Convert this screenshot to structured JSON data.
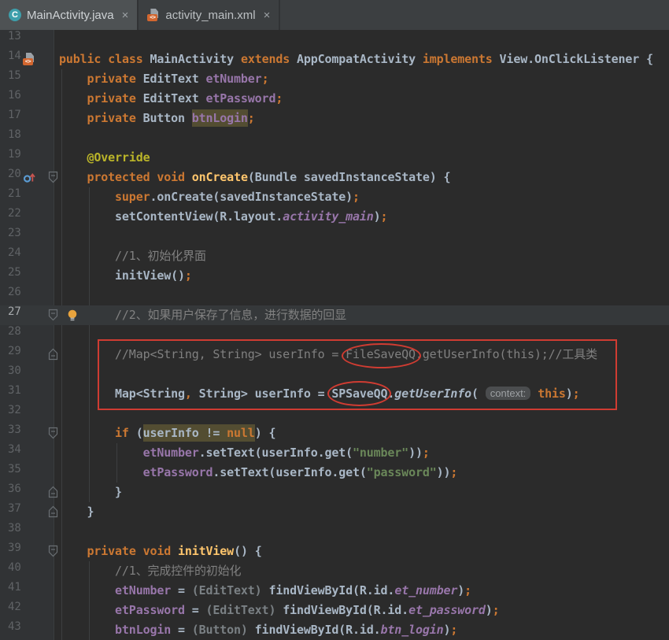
{
  "tabs": [
    {
      "label": "MainActivity.java",
      "close_label": "×",
      "icon": "java-class-icon",
      "active": true
    },
    {
      "label": "activity_main.xml",
      "close_label": "×",
      "icon": "xml-file-icon",
      "active": false
    }
  ],
  "icons": {
    "java_letter": "C",
    "xml_badge": "<>"
  },
  "editor": {
    "current_line": 27,
    "first_line": 13,
    "last_line": 43,
    "colors": {
      "background": "#2b2b2b",
      "gutter": "#313335",
      "caret_row": "#35383a",
      "keyword": "#cc7832",
      "text": "#a9b7c6",
      "field": "#9876aa",
      "method": "#ffc66d",
      "annotation": "#bbb529",
      "comment": "#808080",
      "string": "#6a8759",
      "line_number": "#606366",
      "selection": "#534d32"
    },
    "lines": [
      {
        "n": 13,
        "tokens": []
      },
      {
        "n": 14,
        "gutter": "layout-icon",
        "tokens": [
          {
            "s": "public",
            "c": "kw"
          },
          {
            "s": " ",
            "c": "txt"
          },
          {
            "s": "class",
            "c": "kw"
          },
          {
            "s": " MainActivity ",
            "c": "txt"
          },
          {
            "s": "extends",
            "c": "kw"
          },
          {
            "s": " AppCompatActivity ",
            "c": "txt"
          },
          {
            "s": "implements",
            "c": "kw"
          },
          {
            "s": " View.OnClickListener {",
            "c": "txt"
          }
        ]
      },
      {
        "n": 15,
        "tokens": [
          {
            "s": "    ",
            "c": "txt"
          },
          {
            "s": "private",
            "c": "kw"
          },
          {
            "s": " EditText ",
            "c": "txt"
          },
          {
            "s": "etNumber",
            "c": "fld"
          },
          {
            "s": ";",
            "c": "pun"
          }
        ]
      },
      {
        "n": 16,
        "tokens": [
          {
            "s": "    ",
            "c": "txt"
          },
          {
            "s": "private",
            "c": "kw"
          },
          {
            "s": " EditText ",
            "c": "txt"
          },
          {
            "s": "etPassword",
            "c": "fld"
          },
          {
            "s": ";",
            "c": "pun"
          }
        ]
      },
      {
        "n": 17,
        "tokens": [
          {
            "s": "    ",
            "c": "txt"
          },
          {
            "s": "private",
            "c": "kw"
          },
          {
            "s": " Button ",
            "c": "txt"
          },
          {
            "s": "btnLogin",
            "c": "fld",
            "hl": true
          },
          {
            "s": ";",
            "c": "pun"
          }
        ]
      },
      {
        "n": 18,
        "tokens": []
      },
      {
        "n": 19,
        "tokens": [
          {
            "s": "    ",
            "c": "txt"
          },
          {
            "s": "@Override",
            "c": "ann"
          }
        ]
      },
      {
        "n": 20,
        "gutter": "override-icon",
        "fold": "down",
        "tokens": [
          {
            "s": "    ",
            "c": "txt"
          },
          {
            "s": "protected",
            "c": "kw"
          },
          {
            "s": " ",
            "c": "txt"
          },
          {
            "s": "void",
            "c": "kw"
          },
          {
            "s": " ",
            "c": "txt"
          },
          {
            "s": "onCreate",
            "c": "mth"
          },
          {
            "s": "(Bundle savedInstanceState) {",
            "c": "txt"
          }
        ]
      },
      {
        "n": 21,
        "tokens": [
          {
            "s": "        ",
            "c": "txt"
          },
          {
            "s": "super",
            "c": "kw"
          },
          {
            "s": ".onCreate(savedInstanceState)",
            "c": "txt"
          },
          {
            "s": ";",
            "c": "pun"
          }
        ]
      },
      {
        "n": 22,
        "tokens": [
          {
            "s": "        setContentView(R.layout.",
            "c": "txt"
          },
          {
            "s": "activity_main",
            "c": "fldi"
          },
          {
            "s": ")",
            "c": "txt"
          },
          {
            "s": ";",
            "c": "pun"
          }
        ]
      },
      {
        "n": 23,
        "tokens": []
      },
      {
        "n": 24,
        "tokens": [
          {
            "s": "        ",
            "c": "txt"
          },
          {
            "s": "//1、初始化界面",
            "c": "cmt"
          }
        ]
      },
      {
        "n": 25,
        "tokens": [
          {
            "s": "        initView()",
            "c": "txt"
          },
          {
            "s": ";",
            "c": "pun"
          }
        ]
      },
      {
        "n": 26,
        "tokens": []
      },
      {
        "n": 27,
        "fold": "down",
        "bulb": true,
        "tokens": [
          {
            "s": "        ",
            "c": "txt"
          },
          {
            "s": "//2、如果用户保存了信息，进行数据的回显",
            "c": "cmt"
          }
        ]
      },
      {
        "n": 28,
        "tokens": []
      },
      {
        "n": 29,
        "fold": "up",
        "tokens": [
          {
            "s": "        ",
            "c": "txt"
          },
          {
            "s": "//Map<String, String> userInfo = FileSaveQQ.getUserInfo(this);//工具类",
            "c": "cmt"
          }
        ]
      },
      {
        "n": 30,
        "tokens": []
      },
      {
        "n": 31,
        "tokens": [
          {
            "s": "        Map<String",
            "c": "txt"
          },
          {
            "s": ",",
            "c": "pun"
          },
          {
            "s": " String> userInfo = SPSaveQQ.",
            "c": "txt"
          },
          {
            "s": "getUserInfo",
            "c": "mthi"
          },
          {
            "s": "( ",
            "c": "txt"
          },
          {
            "s": "context:",
            "c": "chip"
          },
          {
            "s": " ",
            "c": "txt"
          },
          {
            "s": "this",
            "c": "kw"
          },
          {
            "s": ")",
            "c": "txt"
          },
          {
            "s": ";",
            "c": "pun"
          }
        ]
      },
      {
        "n": 32,
        "tokens": []
      },
      {
        "n": 33,
        "fold": "down",
        "tokens": [
          {
            "s": "        ",
            "c": "txt"
          },
          {
            "s": "if",
            "c": "kw"
          },
          {
            "s": " (",
            "c": "txt"
          },
          {
            "s": "userInfo != ",
            "c": "txt",
            "hl": true
          },
          {
            "s": "null",
            "c": "kw",
            "hl": true
          },
          {
            "s": ") {",
            "c": "txt"
          }
        ]
      },
      {
        "n": 34,
        "tokens": [
          {
            "s": "            ",
            "c": "txt"
          },
          {
            "s": "etNumber",
            "c": "fld"
          },
          {
            "s": ".setText(userInfo.get(",
            "c": "txt"
          },
          {
            "s": "\"number\"",
            "c": "str"
          },
          {
            "s": "))",
            "c": "txt"
          },
          {
            "s": ";",
            "c": "pun"
          }
        ]
      },
      {
        "n": 35,
        "tokens": [
          {
            "s": "            ",
            "c": "txt"
          },
          {
            "s": "etPassword",
            "c": "fld"
          },
          {
            "s": ".setText(userInfo.get(",
            "c": "txt"
          },
          {
            "s": "\"password\"",
            "c": "str"
          },
          {
            "s": "))",
            "c": "txt"
          },
          {
            "s": ";",
            "c": "pun"
          }
        ]
      },
      {
        "n": 36,
        "fold": "up",
        "tokens": [
          {
            "s": "        }",
            "c": "txt"
          }
        ]
      },
      {
        "n": 37,
        "fold": "up",
        "tokens": [
          {
            "s": "    }",
            "c": "txt"
          }
        ]
      },
      {
        "n": 38,
        "tokens": []
      },
      {
        "n": 39,
        "fold": "down",
        "tokens": [
          {
            "s": "    ",
            "c": "txt"
          },
          {
            "s": "private",
            "c": "kw"
          },
          {
            "s": " ",
            "c": "txt"
          },
          {
            "s": "void",
            "c": "kw"
          },
          {
            "s": " ",
            "c": "txt"
          },
          {
            "s": "initView",
            "c": "mth"
          },
          {
            "s": "() {",
            "c": "txt"
          }
        ]
      },
      {
        "n": 40,
        "tokens": [
          {
            "s": "        ",
            "c": "txt"
          },
          {
            "s": "//1、完成控件的初始化",
            "c": "cmt"
          }
        ]
      },
      {
        "n": 41,
        "tokens": [
          {
            "s": "        ",
            "c": "txt"
          },
          {
            "s": "etNumber",
            "c": "fld"
          },
          {
            "s": " = ",
            "c": "txt"
          },
          {
            "s": "(EditText)",
            "c": "cast"
          },
          {
            "s": " findViewById(R.id.",
            "c": "txt"
          },
          {
            "s": "et_number",
            "c": "fldi"
          },
          {
            "s": ")",
            "c": "txt"
          },
          {
            "s": ";",
            "c": "pun"
          }
        ]
      },
      {
        "n": 42,
        "tokens": [
          {
            "s": "        ",
            "c": "txt"
          },
          {
            "s": "etPassword",
            "c": "fld"
          },
          {
            "s": " = ",
            "c": "txt"
          },
          {
            "s": "(EditText)",
            "c": "cast"
          },
          {
            "s": " findViewById(R.id.",
            "c": "txt"
          },
          {
            "s": "et_password",
            "c": "fldi"
          },
          {
            "s": ")",
            "c": "txt"
          },
          {
            "s": ";",
            "c": "pun"
          }
        ]
      },
      {
        "n": 43,
        "tokens": [
          {
            "s": "        ",
            "c": "txt"
          },
          {
            "s": "btnLogin",
            "c": "fld"
          },
          {
            "s": " = ",
            "c": "txt"
          },
          {
            "s": "(Button)",
            "c": "cast"
          },
          {
            "s": " findViewById(R.id.",
            "c": "txt"
          },
          {
            "s": "btn_login",
            "c": "fldi"
          },
          {
            "s": ")",
            "c": "txt"
          },
          {
            "s": ";",
            "c": "pun"
          }
        ]
      }
    ]
  },
  "annotations": {
    "color": "#d03c32",
    "circled_words": [
      "FileSaveQQ",
      "SPSaveQQ"
    ],
    "boxed_lines": [
      29,
      31
    ]
  }
}
